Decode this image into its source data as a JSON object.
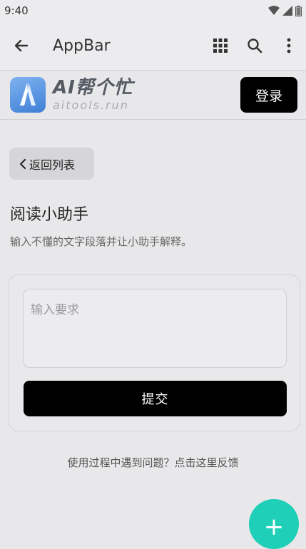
{
  "status_bar": {
    "time": "9:40"
  },
  "appbar": {
    "title": "AppBar",
    "back_icon": "arrow-left-icon",
    "actions": [
      "grid-icon",
      "search-icon",
      "more-vert-icon"
    ]
  },
  "brand": {
    "name": "AI帮个忙",
    "domain": "aitools.run",
    "login_label": "登录"
  },
  "nav": {
    "back_list_label": "返回列表"
  },
  "page": {
    "title": "阅读小助手",
    "description": "输入不懂的文字段落并让小助手解释。"
  },
  "form": {
    "request_placeholder": "输入要求",
    "request_value": "",
    "submit_label": "提交"
  },
  "footer": {
    "feedback_text": "使用过程中遇到问题？点击这里反馈"
  },
  "fab": {
    "icon": "plus-icon",
    "label": "+"
  },
  "colors": {
    "accent_fab": "#1fcfb8",
    "primary_button": "#000000",
    "logo_blue": "#3f7fd6"
  }
}
